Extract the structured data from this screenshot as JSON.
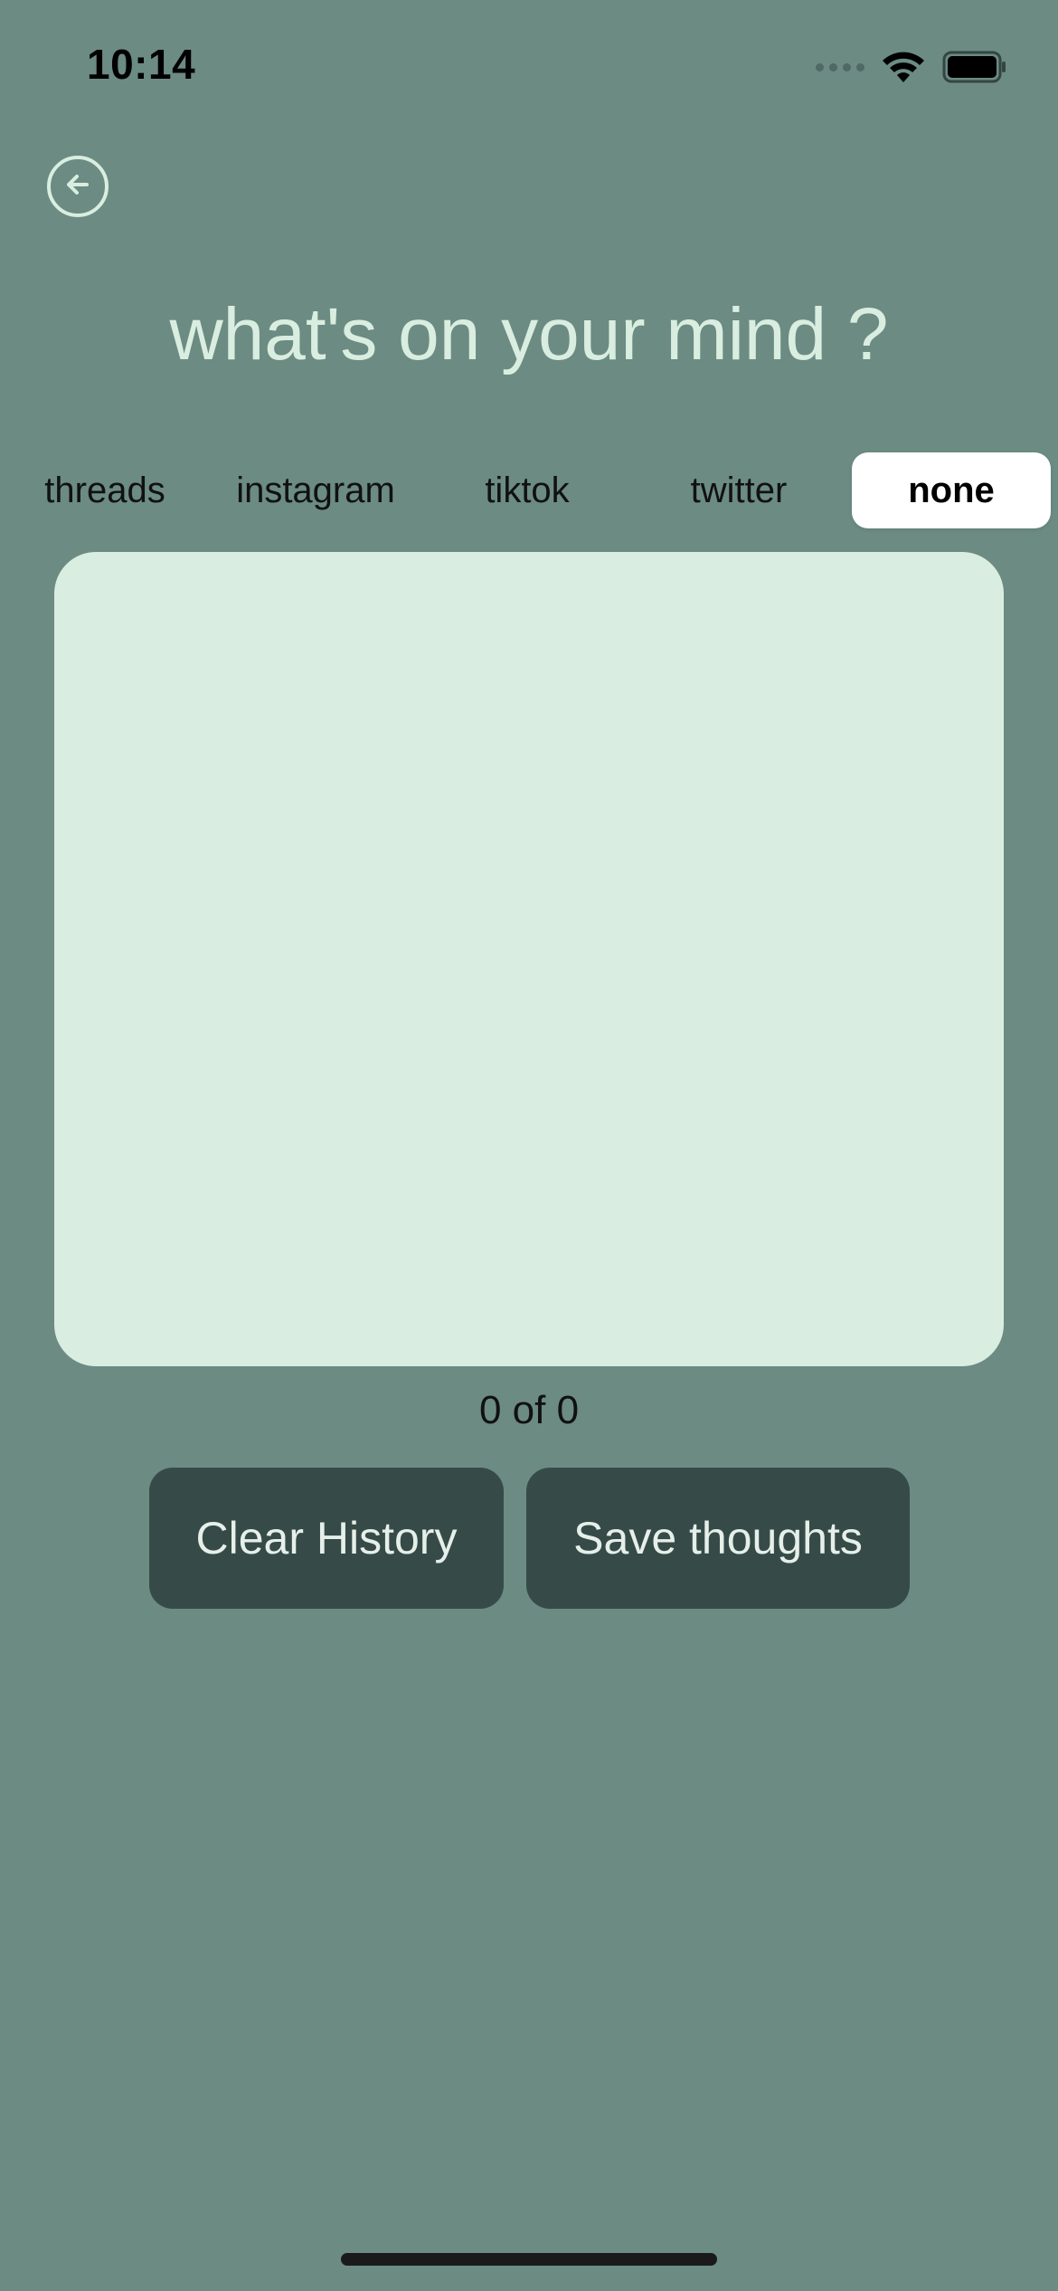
{
  "status_bar": {
    "time": "10:14"
  },
  "header": {
    "back_icon": "arrow-left-circle-icon",
    "title": "what's on your mind ?"
  },
  "tabs": [
    {
      "label": "threads",
      "selected": false
    },
    {
      "label": "instagram",
      "selected": false
    },
    {
      "label": "tiktok",
      "selected": false
    },
    {
      "label": "twitter",
      "selected": false
    },
    {
      "label": "none",
      "selected": true
    }
  ],
  "editor": {
    "value": "",
    "placeholder": ""
  },
  "counter": "0 of 0",
  "actions": {
    "clear_label": "Clear History",
    "save_label": "Save thoughts"
  },
  "colors": {
    "background": "#6b8b83",
    "title": "#d9eee0",
    "editor_bg": "#d9ede0",
    "button_bg": "#364b48",
    "selected_tab_bg": "#ffffff"
  }
}
